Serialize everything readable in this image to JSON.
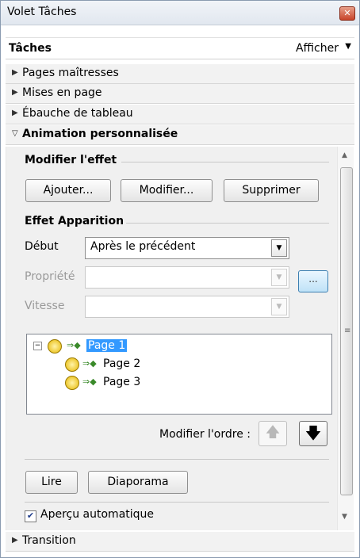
{
  "window": {
    "title": "Volet Tâches"
  },
  "panel": {
    "title": "Tâches",
    "view_menu": "Afficher"
  },
  "sections": {
    "master_pages": "Pages maîtresses",
    "layouts": "Mises en page",
    "table_design": "Ébauche de tableau",
    "custom_animation": "Animation personnalisée",
    "transition": "Transition"
  },
  "modify_effect": {
    "title": "Modifier l'effet",
    "add": "Ajouter...",
    "modify": "Modifier...",
    "remove": "Supprimer"
  },
  "effect": {
    "title": "Effet Apparition",
    "start_label": "Début",
    "start_value": "Après le précédent",
    "property_label": "Propriété",
    "property_value": "",
    "property_button": "...",
    "speed_label": "Vitesse",
    "speed_value": ""
  },
  "tree": {
    "items": [
      {
        "label": "Page 1"
      },
      {
        "label": "Page 2"
      },
      {
        "label": "Page 3"
      }
    ]
  },
  "order": {
    "label": "Modifier l'ordre :"
  },
  "actions": {
    "play": "Lire",
    "slideshow": "Diaporama"
  },
  "preview": {
    "label": "Aperçu automatique",
    "checked": true
  }
}
